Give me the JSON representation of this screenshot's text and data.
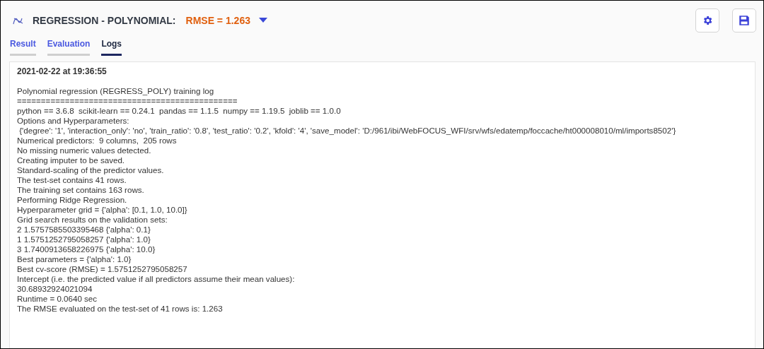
{
  "header": {
    "title": "REGRESSION - POLYNOMIAL:",
    "metric": "RMSE = 1.263"
  },
  "tabs": [
    {
      "label": "Result",
      "selected": false
    },
    {
      "label": "Evaluation",
      "selected": false
    },
    {
      "label": "Logs",
      "selected": true
    }
  ],
  "log": {
    "timestamp": "2021-02-22 at 19:36:55",
    "lines": [
      "Polynomial regression (REGRESS_POLY) training log",
      "==============================================",
      "python == 3.6.8  scikit-learn == 0.24.1  pandas == 1.1.5  numpy == 1.19.5  joblib == 1.0.0",
      "Options and Hyperparameters:",
      " {'degree': '1', 'interaction_only': 'no', 'train_ratio': '0.8', 'test_ratio': '0.2', 'kfold': '4', 'save_model': 'D:/961/ibi/WebFOCUS_WFI/srv/wfs/edatemp/foccache/ht000008010/ml/imports8502'}",
      "Numerical predictors:  9 columns,  205 rows",
      "No missing numeric values detected.",
      "Creating imputer to be saved.",
      "Standard-scaling of the predictor values.",
      "The test-set contains 41 rows.",
      "The training set contains 163 rows.",
      "Performing Ridge Regression.",
      "Hyperparameter grid = {'alpha': [0.1, 1.0, 10.0]}",
      "Grid search results on the validation sets:",
      "2 1.5757585503395468 {'alpha': 0.1}",
      "1 1.5751252795058257 {'alpha': 1.0}",
      "3 1.7400913658226975 {'alpha': 10.0}",
      "Best parameters = {'alpha': 1.0}",
      "Best cv-score (RMSE) = 1.5751252795058257",
      "Intercept (i.e. the predicted value if all predictors assume their mean values):",
      "30.68932924021094",
      "Runtime = 0.0640 sec",
      "The RMSE evaluated on the test-set of 41 rows is: 1.263"
    ]
  }
}
